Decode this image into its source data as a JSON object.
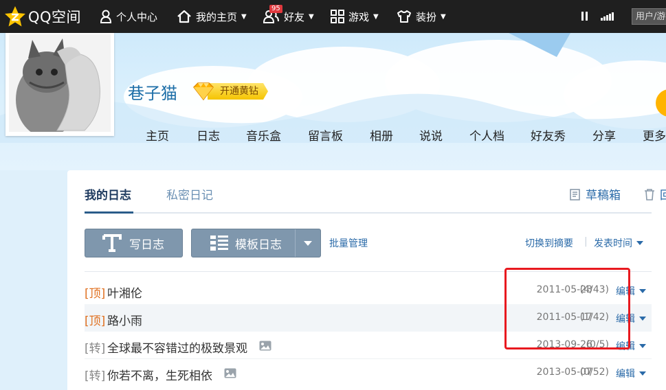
{
  "topbar": {
    "logo_text": "QQ空间",
    "nav": [
      {
        "label": "个人中心",
        "icon": "person-icon",
        "dropdown": false
      },
      {
        "label": "我的主页",
        "icon": "home-icon",
        "dropdown": true
      },
      {
        "label": "好友",
        "icon": "friends-icon",
        "dropdown": true,
        "badge": "95"
      },
      {
        "label": "游戏",
        "icon": "grid-icon",
        "dropdown": true
      },
      {
        "label": "装扮",
        "icon": "shirt-icon",
        "dropdown": true
      }
    ],
    "user_box": "用户/游"
  },
  "profile": {
    "username": "巷子猫",
    "vip_label": "开通黄钻"
  },
  "main_tabs": [
    "主页",
    "日志",
    "音乐盒",
    "留言板",
    "相册",
    "说说",
    "个人档",
    "好友秀",
    "分享",
    "更多"
  ],
  "blog": {
    "subtabs": {
      "mine": "我的日志",
      "private": "私密日记"
    },
    "drafts": "草稿箱",
    "recycle": "回",
    "write_button": "写日志",
    "template_button": "模板日志",
    "batch": "批量管理",
    "switch_summary": "切换到摘要",
    "separator": "|",
    "sort": "发表时间",
    "entries": [
      {
        "tag": "[顶]",
        "title": "叶湘伦",
        "date": "2011-05-23",
        "count": "(4/43)",
        "edit": "编辑",
        "has_pic": false
      },
      {
        "tag": "[顶]",
        "title": "路小雨",
        "date": "2011-05-17",
        "count": "(1/42)",
        "edit": "编辑",
        "has_pic": false
      },
      {
        "tag": "[转]",
        "title": "全球最不容错过的极致景观",
        "date": "2013-09-26",
        "count": "(0/5)",
        "edit": "编辑",
        "has_pic": true
      },
      {
        "tag": "[转]",
        "title": "你若不离，生死相依",
        "date": "2013-05-07",
        "count": "(0/52)",
        "edit": "编辑",
        "has_pic": true
      }
    ]
  },
  "colors": {
    "topbar_bg": "#1f1f1f",
    "link_blue": "#2a6aa8",
    "top_tag_orange": "#e07020",
    "highlight_red": "#e8191f",
    "button_gray_blue": "#7f97ad"
  }
}
